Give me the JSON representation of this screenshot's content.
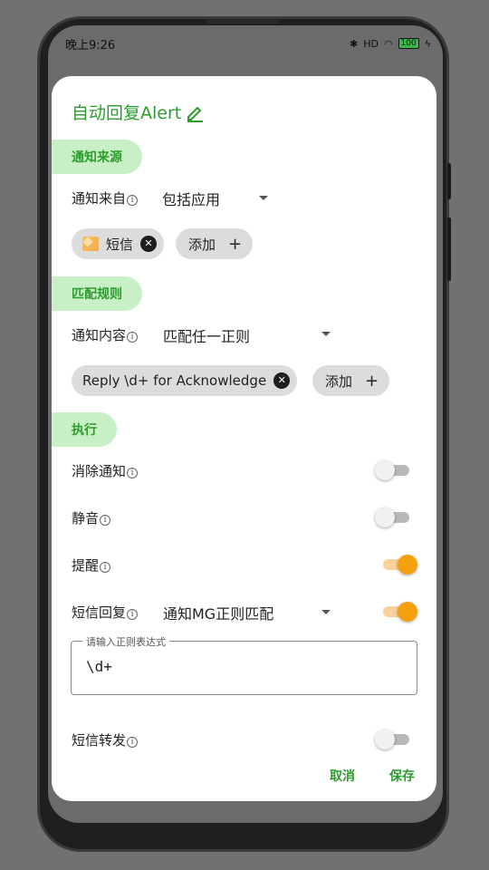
{
  "status_bar": {
    "time": "晚上9:26",
    "network": "HD",
    "battery": "100"
  },
  "dialog": {
    "title": "自动回复Alert",
    "sections": {
      "source": "通知来源",
      "rules": "匹配规则",
      "execute": "执行"
    },
    "notify_from": {
      "label": "通知来自",
      "value": "包括应用"
    },
    "apps_chips": [
      {
        "label": "短信"
      }
    ],
    "add_label": "添加",
    "notify_content": {
      "label": "通知内容",
      "value": "匹配任一正则"
    },
    "regex_chips": [
      {
        "label": "Reply \\d+ for Acknowledge"
      }
    ],
    "toggles": {
      "dismiss": {
        "label": "消除通知",
        "on": false
      },
      "mute": {
        "label": "静音",
        "on": false
      },
      "remind": {
        "label": "提醒",
        "on": true
      },
      "sms_reply": {
        "label": "短信回复",
        "on": true,
        "mode": "通知MG正则匹配"
      },
      "sms_forward": {
        "label": "短信转发",
        "on": false
      }
    },
    "regex_input": {
      "legend": "请输入正则表达式",
      "value": "\\d+"
    },
    "buttons": {
      "cancel": "取消",
      "save": "保存"
    }
  }
}
